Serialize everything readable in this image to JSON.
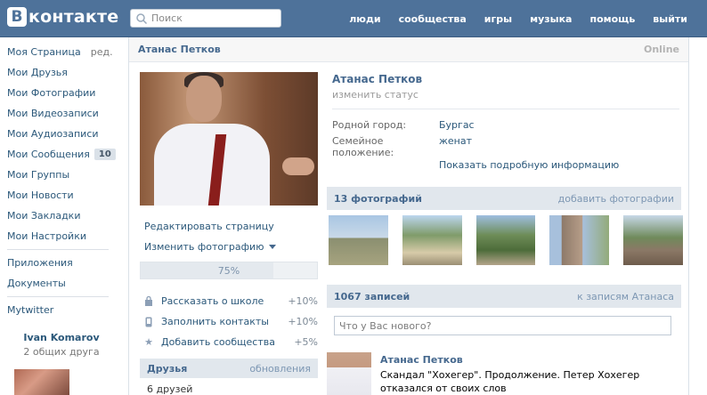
{
  "header": {
    "logo_mark": "B",
    "logo_text": "контакте",
    "search_placeholder": "Поиск",
    "nav": [
      "люди",
      "сообщества",
      "игры",
      "музыка",
      "помощь",
      "выйти"
    ]
  },
  "sidebar": {
    "my_page": "Моя Страница",
    "edit": "ред.",
    "items": [
      "Мои Друзья",
      "Мои Фотографии",
      "Мои Видеозаписи",
      "Мои Аудиозаписи"
    ],
    "messages": "Мои Сообщения",
    "messages_count": "10",
    "items2": [
      "Мои Группы",
      "Мои Новости",
      "Мои Закладки",
      "Мои Настройки"
    ],
    "apps": [
      "Приложения",
      "Документы"
    ],
    "extra": "Mytwitter",
    "friend_name": "Ivan Komarov",
    "friend_common": "2 общих друга"
  },
  "profile": {
    "header_name": "Атанас Петков",
    "online": "Online",
    "edit_page": "Редактировать страницу",
    "change_photo": "Изменить фотографию",
    "progress_value": 75,
    "progress_label": "75%",
    "tasks": [
      {
        "label": "Рассказать о школе",
        "pct": "+10%",
        "icon": "lock-icon"
      },
      {
        "label": "Заполнить контакты",
        "pct": "+10%",
        "icon": "phone-icon"
      },
      {
        "label": "Добавить сообщества",
        "pct": "+5%",
        "icon": "star-icon"
      }
    ],
    "friends_title": "Друзья",
    "friends_link": "обновления",
    "friends_count": "6 друзей"
  },
  "info": {
    "name": "Атанас Петков",
    "status": "изменить статус",
    "hometown_label": "Родной город:",
    "hometown_value": "Бургас",
    "family_label": "Семейное положение:",
    "family_value": "женат",
    "more": "Показать подробную информацию"
  },
  "photos": {
    "title": "13 фотографий",
    "add": "добавить фотографии"
  },
  "wall": {
    "title": "1067 записей",
    "link": "к записям Атанаса",
    "placeholder": "Что у Вас нового?",
    "post_author": "Атанас Петков",
    "post_text": "Скандал \"Хохегер\". Продолжение. Петер Хохегер отказался от своих слов"
  },
  "colors": {
    "header_bg": "#4e729a",
    "link": "#2b587a",
    "section_bg": "#e1e7ed"
  }
}
